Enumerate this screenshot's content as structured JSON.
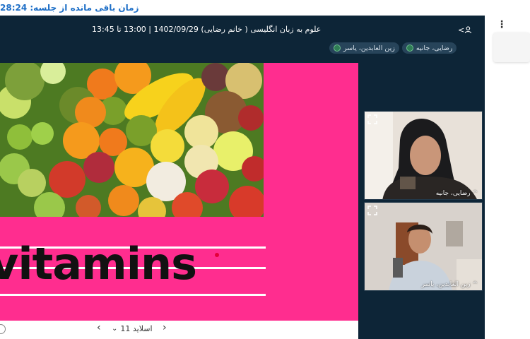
{
  "timer": {
    "text": "زمان باقی مانده از جلسه: 28:24"
  },
  "session": {
    "title": "علوم به زبان انگلیسی ( خانم رضایی) 1402/09/29 | 13:00 تا 13:45"
  },
  "header": {
    "user_icon": "user-icon",
    "chevron": "<"
  },
  "chips": [
    {
      "label": "رضایی، جانیه"
    },
    {
      "label": "زین العابدین، یاسر"
    }
  ],
  "slide": {
    "word": "vitamins",
    "nav": {
      "prev": "‹",
      "label": "اسلاید 11",
      "chevron": "⌄",
      "next": "›"
    }
  },
  "videos": [
    {
      "name": "^ رضایی، جانیه"
    },
    {
      "name": "^ زین العابدین، یاسر"
    }
  ],
  "colors": {
    "accent": "#1e6fc7",
    "slide_bg": "#ff2d8f",
    "app_bg": "#0d2537"
  }
}
